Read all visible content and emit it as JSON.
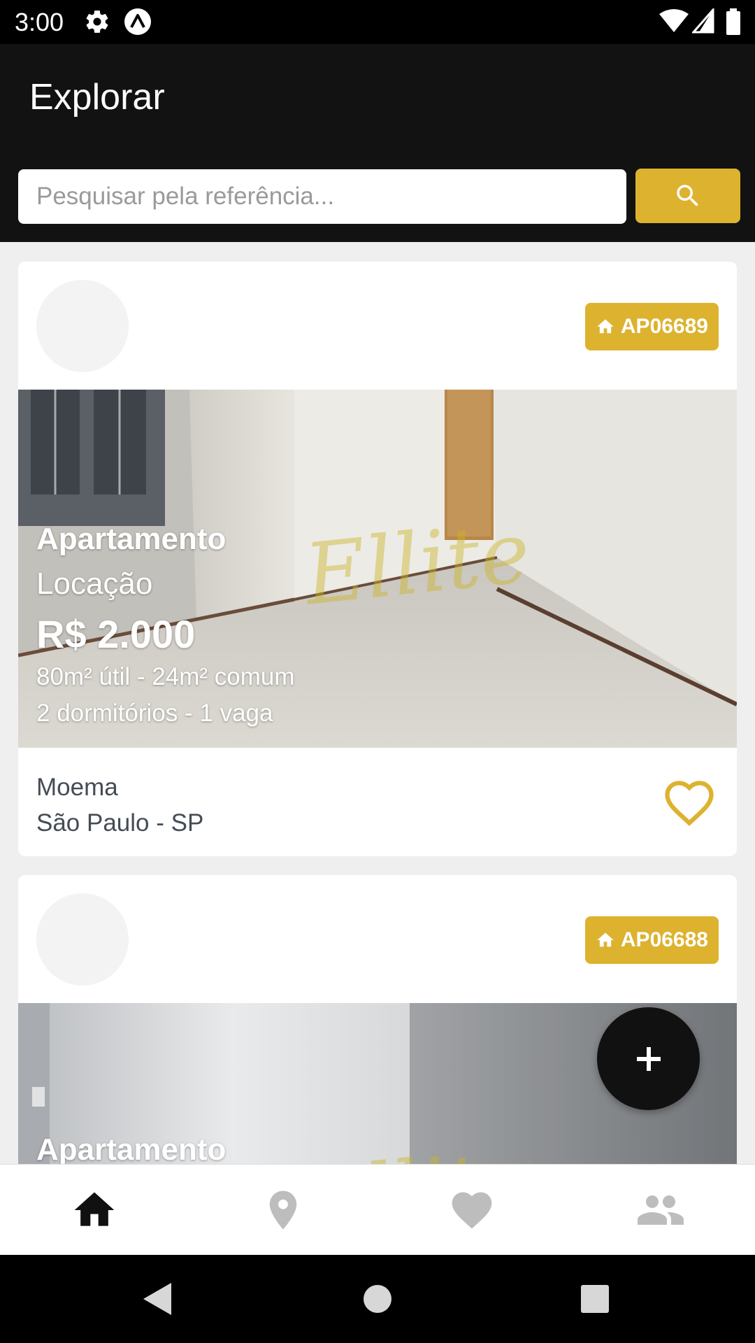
{
  "status_bar": {
    "time": "3:00"
  },
  "app_bar": {
    "title": "Explorar"
  },
  "search": {
    "placeholder": "Pesquisar pela referência..."
  },
  "listings": [
    {
      "ref": "AP06689",
      "type": "Apartamento",
      "transaction": "Locação",
      "price": "R$ 2.000",
      "area": "80m² útil - 24m² comum",
      "rooms": "2 dormitórios - 1 vaga",
      "neighborhood": "Moema",
      "city": "São Paulo - SP",
      "watermark": "Ellite"
    },
    {
      "ref": "AP06688",
      "type": "Apartamento",
      "watermark": "Ellite"
    }
  ],
  "fab": {
    "icon": "plus-icon"
  },
  "bottom_nav": [
    {
      "icon": "home-icon",
      "active": true
    },
    {
      "icon": "location-pin-icon",
      "active": false
    },
    {
      "icon": "heart-icon",
      "active": false
    },
    {
      "icon": "people-icon",
      "active": false
    }
  ],
  "colors": {
    "accent": "#DDB22E",
    "app_bar": "#121212",
    "background": "#EFEFEF",
    "nav_inactive": "#BDBDBD",
    "nav_active": "#111111"
  }
}
